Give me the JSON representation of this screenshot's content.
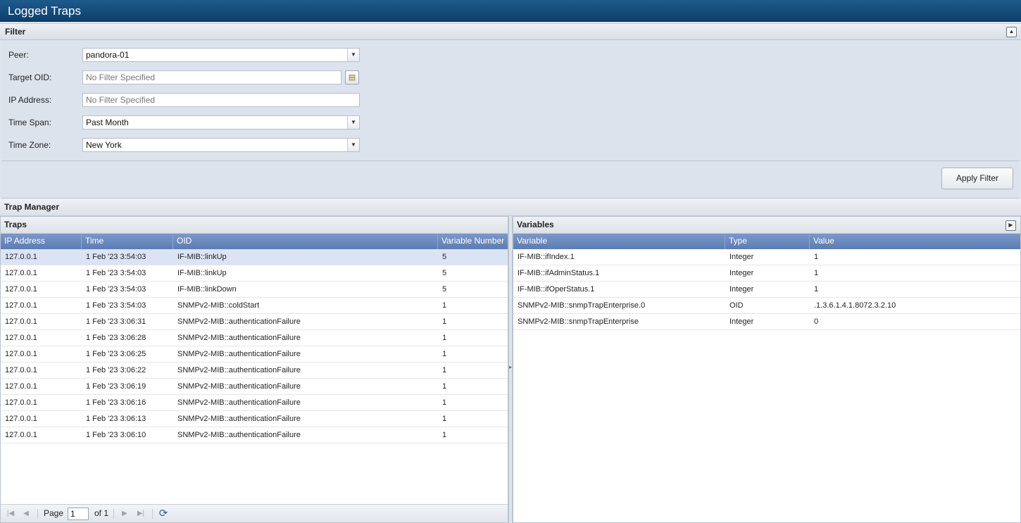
{
  "window": {
    "title": "Logged Traps"
  },
  "filter": {
    "title": "Filter",
    "collapse_icon": "collapse-up-icon",
    "fields": {
      "peer": {
        "label": "Peer:",
        "value": "pandora-01"
      },
      "target_oid": {
        "label": "Target OID:",
        "placeholder": "No Filter Specified"
      },
      "ip_address": {
        "label": "IP Address:",
        "placeholder": "No Filter Specified"
      },
      "time_span": {
        "label": "Time Span:",
        "value": "Past Month"
      },
      "time_zone": {
        "label": "Time Zone:",
        "value": "New York"
      }
    },
    "apply_label": "Apply Filter"
  },
  "trap_manager": {
    "title": "Trap Manager"
  },
  "traps": {
    "title": "Traps",
    "columns": [
      "IP Address",
      "Time",
      "OID",
      "Variable Number"
    ],
    "rows": [
      [
        "127.0.0.1",
        "1 Feb '23 3:54:03",
        "IF-MIB::linkUp",
        "5"
      ],
      [
        "127.0.0.1",
        "1 Feb '23 3:54:03",
        "IF-MIB::linkUp",
        "5"
      ],
      [
        "127.0.0.1",
        "1 Feb '23 3:54:03",
        "IF-MIB::linkDown",
        "5"
      ],
      [
        "127.0.0.1",
        "1 Feb '23 3:54:03",
        "SNMPv2-MIB::coldStart",
        "1"
      ],
      [
        "127.0.0.1",
        "1 Feb '23 3:06:31",
        "SNMPv2-MIB::authenticationFailure",
        "1"
      ],
      [
        "127.0.0.1",
        "1 Feb '23 3:06:28",
        "SNMPv2-MIB::authenticationFailure",
        "1"
      ],
      [
        "127.0.0.1",
        "1 Feb '23 3:06:25",
        "SNMPv2-MIB::authenticationFailure",
        "1"
      ],
      [
        "127.0.0.1",
        "1 Feb '23 3:06:22",
        "SNMPv2-MIB::authenticationFailure",
        "1"
      ],
      [
        "127.0.0.1",
        "1 Feb '23 3:06:19",
        "SNMPv2-MIB::authenticationFailure",
        "1"
      ],
      [
        "127.0.0.1",
        "1 Feb '23 3:06:16",
        "SNMPv2-MIB::authenticationFailure",
        "1"
      ],
      [
        "127.0.0.1",
        "1 Feb '23 3:06:13",
        "SNMPv2-MIB::authenticationFailure",
        "1"
      ],
      [
        "127.0.0.1",
        "1 Feb '23 3:06:10",
        "SNMPv2-MIB::authenticationFailure",
        "1"
      ]
    ],
    "selected_row": 0,
    "pager": {
      "page_label": "Page",
      "page_value": "1",
      "of_label": "of 1"
    }
  },
  "variables": {
    "title": "Variables",
    "expand_icon": "expand-right-icon",
    "columns": [
      "Variable",
      "Type",
      "Value"
    ],
    "rows": [
      [
        "IF-MIB::ifIndex.1",
        "Integer",
        "1"
      ],
      [
        "IF-MIB::ifAdminStatus.1",
        "Integer",
        "1"
      ],
      [
        "IF-MIB::ifOperStatus.1",
        "Integer",
        "1"
      ],
      [
        "SNMPv2-MIB::snmpTrapEnterprise.0",
        "OID",
        ".1.3.6.1.4.1.8072.3.2.10"
      ],
      [
        "SNMPv2-MIB::snmpTrapEnterprise",
        "Integer",
        "0"
      ]
    ]
  },
  "colors": {
    "title_bar": "#0f3f6a",
    "grid_header": "#5c7cb3",
    "selected_row": "#dbe4f4"
  }
}
